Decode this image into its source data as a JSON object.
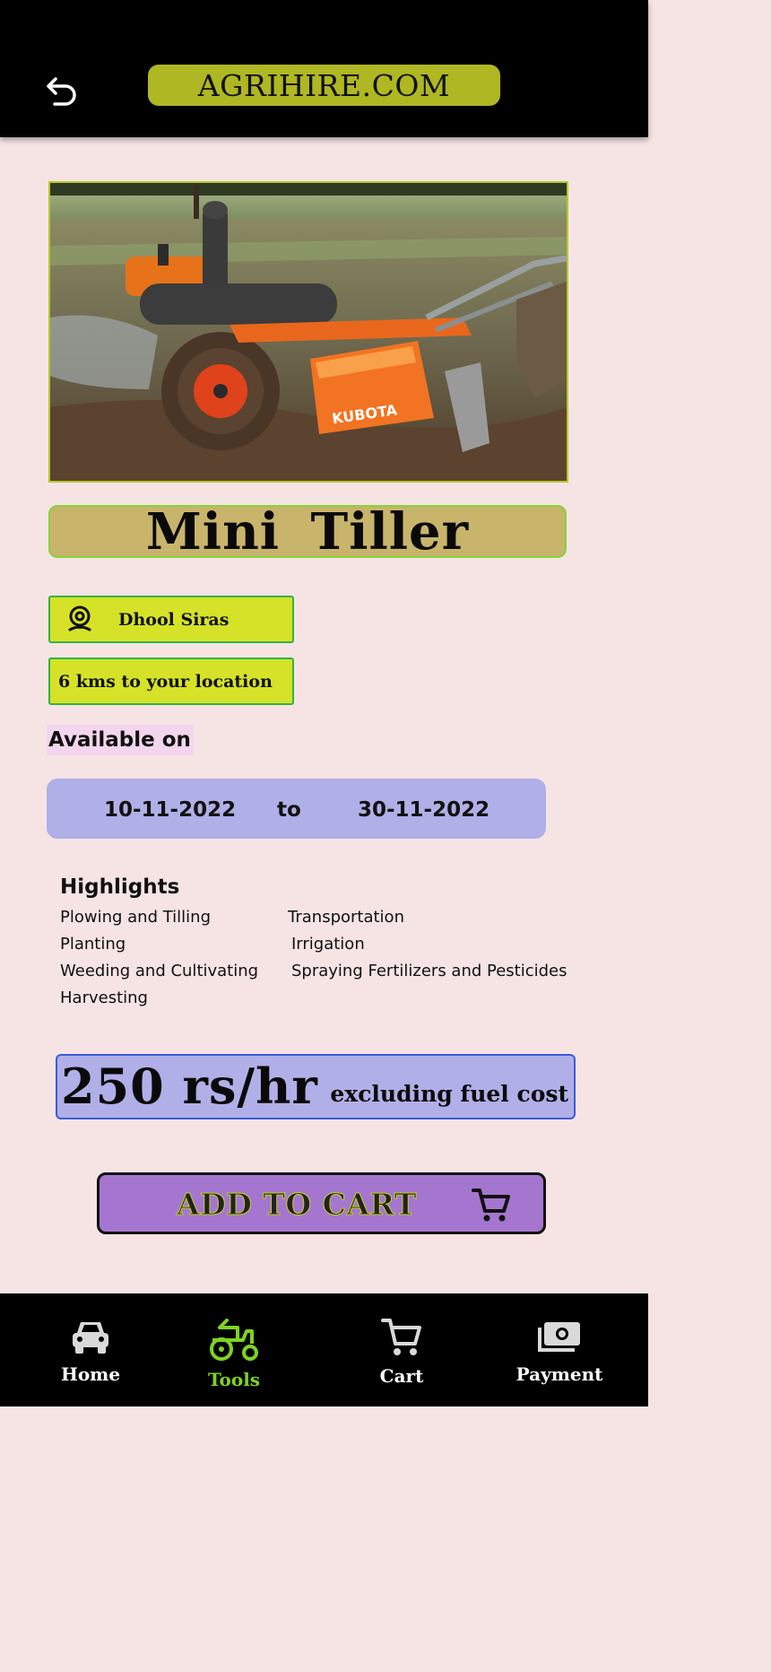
{
  "header": {
    "brand": "AGRIHIRE.COM",
    "back_icon": "back-arrow-icon"
  },
  "product": {
    "image_alt": "Mini Tiller",
    "brand_mark": "KUBOTA",
    "name": "Mini Tiller",
    "location": "Dhool Siras",
    "distance": "6 kms to your location",
    "available_label": "Available on",
    "date_from": "10-11-2022",
    "date_sep": "to",
    "date_to": "30-11-2022"
  },
  "highlights": {
    "title": "Highlights",
    "left": [
      "Plowing and Tilling",
      "Planting",
      "Weeding and Cultivating",
      "Harvesting"
    ],
    "right": [
      "Transportation",
      "Irrigation",
      "Spraying Fertilizers and Pesticides"
    ]
  },
  "price": {
    "amount": "250 rs/hr",
    "note": "excluding fuel cost"
  },
  "actions": {
    "add_to_cart": "ADD TO CART"
  },
  "nav": {
    "items": [
      {
        "label": "Home",
        "icon": "car-icon",
        "active": false
      },
      {
        "label": "Tools",
        "icon": "tractor-icon",
        "active": true
      },
      {
        "label": "Cart",
        "icon": "cart-icon",
        "active": false
      },
      {
        "label": "Payment",
        "icon": "cash-icon",
        "active": false
      }
    ]
  },
  "colors": {
    "brand_pill": "#afb723",
    "active_nav": "#7ed321",
    "background": "#f6e4e4"
  }
}
